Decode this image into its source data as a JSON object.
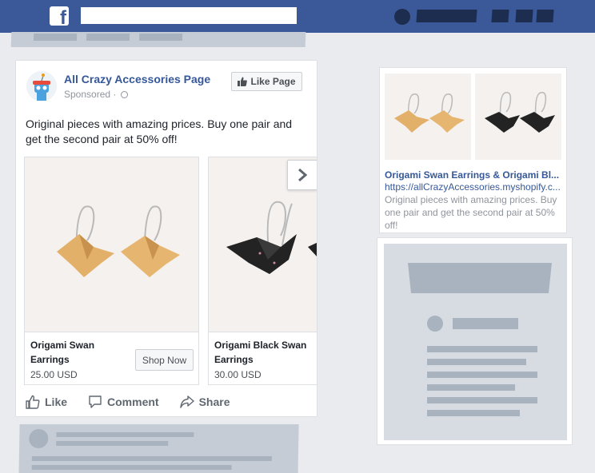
{
  "post": {
    "page_name": "All Crazy Accessories Page",
    "sponsored": "Sponsored",
    "sponsored_sep": " ·",
    "like_page_label": "Like Page",
    "text": "Original pieces with amazing prices. Buy one pair and get the second pair at 50% off!",
    "cards": [
      {
        "title": "Origami Swan Earrings",
        "price": "25.00 USD",
        "cta": "Shop Now"
      },
      {
        "title": "Origami Black Swan Earrings",
        "price": "30.00 USD"
      }
    ],
    "actions": {
      "like": "Like",
      "comment": "Comment",
      "share": "Share"
    }
  },
  "rhs_ad": {
    "title": "Origami Swan Earrings & Origami Bl...",
    "url": "https://allCrazyAccessories.myshopify.c...",
    "description": "Original pieces with amazing prices. Buy one pair and get the second pair at 50% off!"
  },
  "colors": {
    "topbar": "#3b5998",
    "link": "#365899",
    "background": "#e9ebee",
    "placeholder": "#c5ccd6"
  },
  "icons": {
    "logo": "facebook-logo",
    "like": "thumbs-up-icon",
    "comment": "comment-bubble-icon",
    "share": "share-arrow-icon",
    "next": "chevron-right-icon",
    "audience": "globe-icon"
  }
}
